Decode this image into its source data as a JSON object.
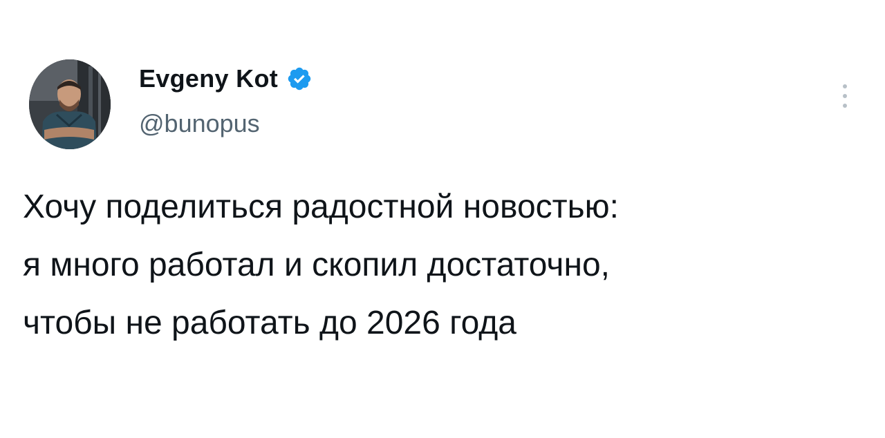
{
  "author": {
    "name": "Evgeny Kot",
    "handle": "@bunopus",
    "verified": true,
    "verified_icon": "verified-badge-icon",
    "avatar": "avatar-photo"
  },
  "tweet": {
    "lines": [
      "Хочу поделиться радостной новостью:",
      "я много работал и скопил достаточно,",
      "чтобы не работать до 2026 года"
    ]
  },
  "actions": {
    "more_icon": "more-vertical-icon"
  },
  "colors": {
    "text_primary": "#0f1419",
    "text_secondary": "#536471",
    "verified_blue": "#1d9bf0",
    "more_dots": "#b7c0c7",
    "background": "#ffffff"
  }
}
